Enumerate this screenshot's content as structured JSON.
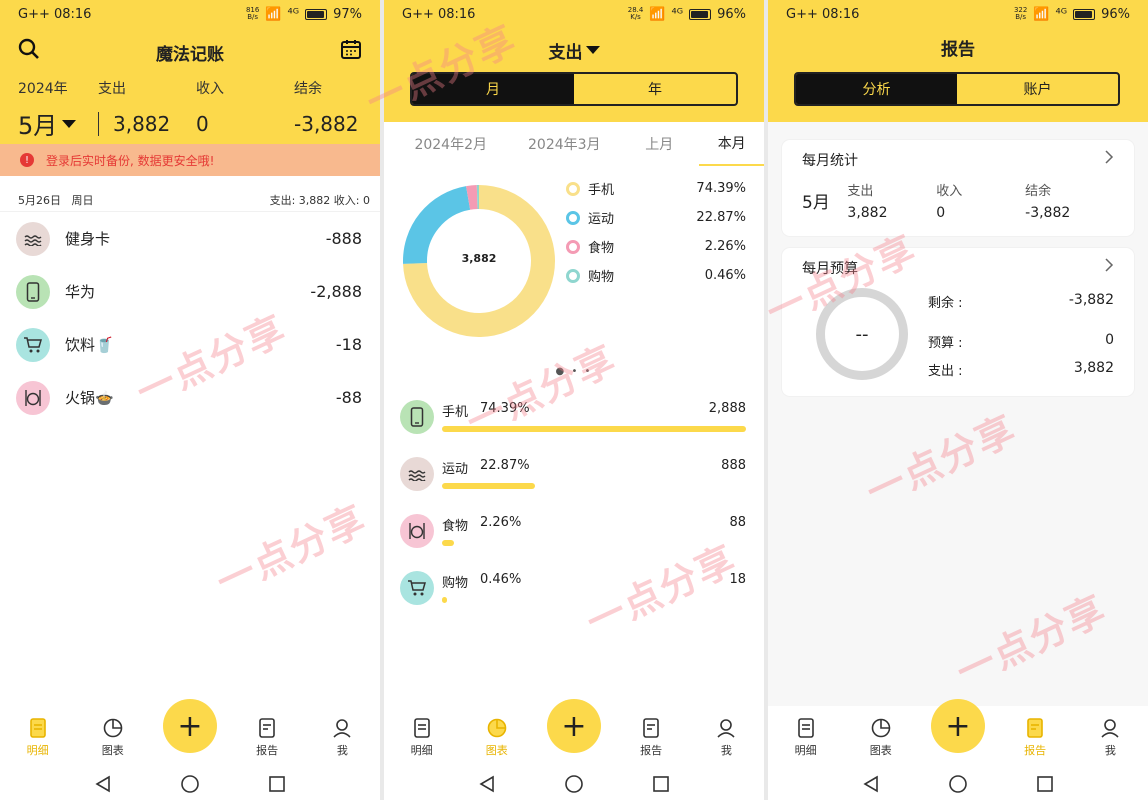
{
  "status_bar": [
    {
      "time": "G++ 08:16",
      "speed_top": "816",
      "speed_bottom": "B/s",
      "signal": "⁴ᴳ",
      "battery": "97%",
      "battery_level": 0.97
    },
    {
      "time": "G++ 08:16",
      "speed_top": "28.4",
      "speed_bottom": "K/s",
      "signal": "⁴ᴳ",
      "battery": "96%",
      "battery_level": 0.96
    },
    {
      "time": "G++ 08:16",
      "speed_top": "322",
      "speed_bottom": "B/s",
      "signal": "⁴ᴳ",
      "battery": "96%",
      "battery_level": 0.96
    }
  ],
  "details": {
    "title": "魔法记账",
    "year": "2024年",
    "month": "5月",
    "expense_label": "支出",
    "expense_value": "3,882",
    "income_label": "收入",
    "income_value": "0",
    "balance_label": "结余",
    "balance_value": "-3,882",
    "banner": "登录后实时备份, 数据更安全哦!",
    "day": {
      "date": "5月26日",
      "weekday": "周日",
      "summary": "支出: 3,882   收入: 0"
    },
    "records": [
      {
        "name": "健身卡",
        "amount": "-888",
        "icon": "swim-icon"
      },
      {
        "name": "华为",
        "amount": "-2,888",
        "icon": "phone-icon"
      },
      {
        "name": "饮料🥤",
        "amount": "-18",
        "icon": "cart-icon"
      },
      {
        "name": "火锅🍲",
        "amount": "-88",
        "icon": "food-icon"
      }
    ]
  },
  "charts": {
    "title": "支出",
    "seg_month": "月",
    "seg_year": "年",
    "periods": [
      "2024年2月",
      "2024年3月",
      "上月",
      "本月"
    ],
    "total": "3,882",
    "legend": [
      {
        "name": "手机",
        "pct": "74.39%",
        "color": "#f9e08a"
      },
      {
        "name": "运动",
        "pct": "22.87%",
        "color": "#5bc5e6"
      },
      {
        "name": "食物",
        "pct": "2.26%",
        "color": "#f49bb4"
      },
      {
        "name": "购物",
        "pct": "0.46%",
        "color": "#8fd6cf"
      }
    ],
    "ranking": [
      {
        "name": "手机",
        "pct": "74.39%",
        "amount": "2,888",
        "fraction": 1.0,
        "icon": "phone-icon"
      },
      {
        "name": "运动",
        "pct": "22.87%",
        "amount": "888",
        "fraction": 0.3075,
        "icon": "swim-icon"
      },
      {
        "name": "食物",
        "pct": "2.26%",
        "amount": "88",
        "fraction": 0.0305,
        "icon": "food-icon"
      },
      {
        "name": "购物",
        "pct": "0.46%",
        "amount": "18",
        "fraction": 0.0062,
        "icon": "cart-icon"
      }
    ]
  },
  "chart_data": {
    "type": "pie",
    "categories": [
      "手机",
      "运动",
      "食物",
      "购物"
    ],
    "values": [
      74.39,
      22.87,
      2.26,
      0.46
    ],
    "title": "3,882"
  },
  "report": {
    "title": "报告",
    "seg_analysis": "分析",
    "seg_account": "账户",
    "monthly_stats": {
      "title": "每月统计",
      "month": "5月",
      "expense_label": "支出",
      "expense_value": "3,882",
      "income_label": "收入",
      "income_value": "0",
      "balance_label": "结余",
      "balance_value": "-3,882"
    },
    "budget": {
      "title": "每月预算",
      "ring_text": "--",
      "remain_label": "剩余 :",
      "remain_value": "-3,882",
      "budget_label": "预算 :",
      "budget_value": "0",
      "spent_label": "支出 :",
      "spent_value": "3,882"
    }
  },
  "tabbar": {
    "details": "明细",
    "chart": "图表",
    "report": "报告",
    "me": "我",
    "add": "+"
  },
  "watermark": "一点分享"
}
